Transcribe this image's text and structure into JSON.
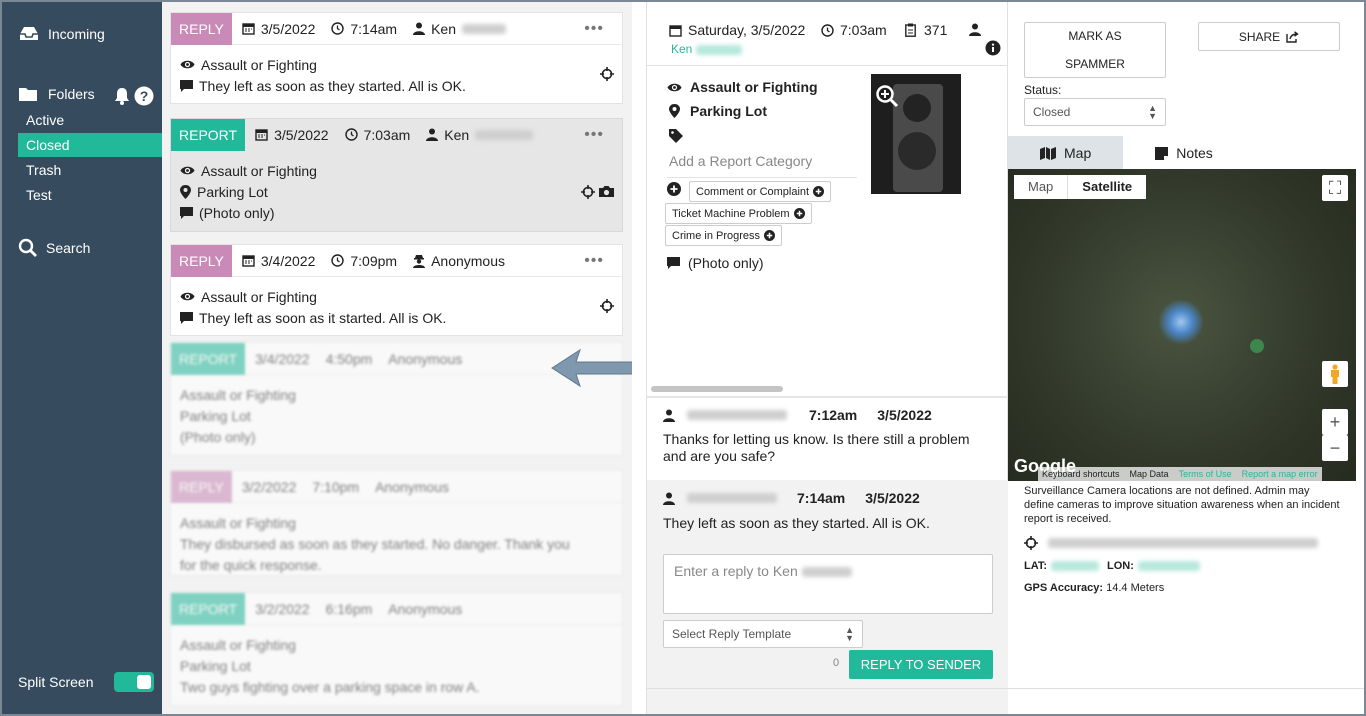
{
  "sidebar": {
    "incoming": "Incoming",
    "folders": "Folders",
    "items": [
      {
        "label": "Active"
      },
      {
        "label": "Closed"
      },
      {
        "label": "Trash"
      },
      {
        "label": "Test"
      }
    ],
    "search": "Search",
    "split_screen": "Split Screen",
    "split_screen_on": true
  },
  "list": {
    "cards": [
      {
        "tag": "REPLY",
        "date": "3/5/2022",
        "time": "7:14am",
        "user": "Ken",
        "lines": [
          "Assault or Fighting",
          "They left as soon as they started. All is OK."
        ]
      },
      {
        "tag": "REPORT",
        "date": "3/5/2022",
        "time": "7:03am",
        "user": "Ken",
        "lines": [
          "Assault or Fighting",
          "Parking Lot",
          "(Photo only)"
        ]
      },
      {
        "tag": "REPLY",
        "date": "3/4/2022",
        "time": "7:09pm",
        "user": "Anonymous",
        "lines": [
          "Assault or Fighting",
          "They left as soon as it started. All is OK."
        ]
      },
      {
        "tag": "REPORT",
        "date": "3/4/2022",
        "time": "4:50pm",
        "user": "Anonymous",
        "lines": [
          "Assault or Fighting",
          "Parking Lot",
          "(Photo only)"
        ]
      },
      {
        "tag": "REPLY",
        "date": "3/2/2022",
        "time": "7:10pm",
        "user": "Anonymous",
        "lines": [
          "Assault or Fighting",
          "They disbursed as soon as they started. No danger. Thank you",
          "for the quick response."
        ]
      },
      {
        "tag": "REPORT",
        "date": "3/2/2022",
        "time": "6:16pm",
        "user": "Anonymous",
        "lines": [
          "Assault or Fighting",
          "Parking Lot",
          "Two guys fighting over a parking space in row A."
        ]
      }
    ]
  },
  "detail": {
    "date": "Saturday, 3/5/2022",
    "time": "7:03am",
    "count": "371",
    "user": "Ken",
    "category": "Assault or Fighting",
    "location": "Parking Lot",
    "add_category_placeholder": "Add a Report Category",
    "chips": [
      "Comment or Complaint",
      "Ticket Machine Problem",
      "Crime in Progress"
    ],
    "photo_only": "(Photo only)",
    "messages": [
      {
        "time": "7:12am",
        "date": "3/5/2022",
        "text": "Thanks for letting us know. Is there still a problem and are you safe?"
      },
      {
        "time": "7:14am",
        "date": "3/5/2022",
        "text": "They left as soon as they started. All is OK."
      }
    ],
    "reply_placeholder": "Enter a reply to Ken",
    "template_select": "Select Reply Template",
    "char_count": "0",
    "reply_button": "REPLY TO SENDER"
  },
  "right": {
    "mark_spammer": "MARK AS SPAMMER",
    "share": "SHARE",
    "status_label": "Status:",
    "status_value": "Closed",
    "tabs": [
      "Map",
      "Notes"
    ],
    "map_types": [
      "Map",
      "Satellite"
    ],
    "map_footer": [
      "Keyboard shortcuts",
      "Map Data",
      "Terms of Use",
      "Report a map error"
    ],
    "google": "Google",
    "notice": "Surveillance Camera locations are not defined. Admin may define cameras to improve situation awareness when an incident report is received.",
    "lat_label": "LAT:",
    "lon_label": "LON:",
    "gps_label": "GPS Accuracy:",
    "gps_value": "14.4 Meters"
  },
  "colors": {
    "accent": "#22b99a",
    "reply_tag": "#c98ab8",
    "sidebar": "#374b5e"
  }
}
